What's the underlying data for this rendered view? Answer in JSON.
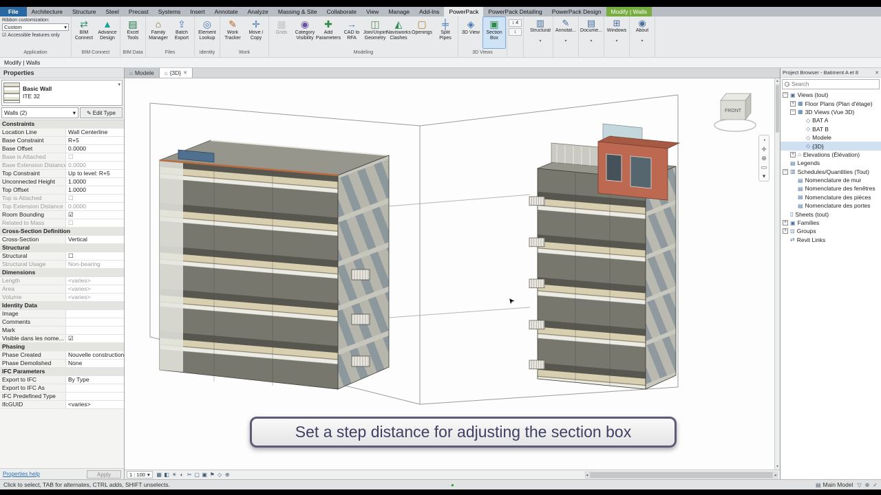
{
  "icons": {
    "caret": "▾",
    "close": "✕",
    "up": "▴",
    "down": "▾",
    "left": "◂",
    "right": "▸",
    "checkbox_checked": "☑",
    "home": "⌂",
    "cursor": "➤"
  },
  "ribbon": {
    "tabs": [
      {
        "label": "File",
        "cls": "file"
      },
      {
        "label": "Architecture"
      },
      {
        "label": "Structure"
      },
      {
        "label": "Steel"
      },
      {
        "label": "Precast"
      },
      {
        "label": "Systems"
      },
      {
        "label": "Insert"
      },
      {
        "label": "Annotate"
      },
      {
        "label": "Analyze"
      },
      {
        "label": "Massing & Site"
      },
      {
        "label": "Collaborate"
      },
      {
        "label": "View"
      },
      {
        "label": "Manage"
      },
      {
        "label": "Add-Ins"
      },
      {
        "label": "PowerPack",
        "cls": "active"
      },
      {
        "label": "PowerPack Detailing"
      },
      {
        "label": "PowerPack Design"
      },
      {
        "label": "Modify | Walls",
        "cls": "modify"
      }
    ],
    "left": {
      "customize_label": "Ribbon customization:",
      "customize_value": "Custom",
      "accessible_label": "Accessible features only",
      "group_label": "Application"
    },
    "groups": [
      {
        "name": "BIM Connect",
        "buttons": [
          {
            "label": "BIM Connect",
            "glyph": "⇄",
            "color": "#2e8b6a"
          },
          {
            "label": "Advance Design",
            "glyph": "▲",
            "color": "#17a398"
          }
        ]
      },
      {
        "name": "BIM Data",
        "buttons": [
          {
            "label": "Excel Tools",
            "glyph": "▤",
            "color": "#1d6f42"
          }
        ]
      },
      {
        "name": "Files",
        "buttons": [
          {
            "label": "Family Manager",
            "glyph": "⌂",
            "color": "#8a6d3b"
          },
          {
            "label": "Batch Export",
            "glyph": "⇪",
            "color": "#4a7ab5"
          }
        ]
      },
      {
        "name": "Identity",
        "buttons": [
          {
            "label": "Element Lookup",
            "glyph": "◎",
            "color": "#4a7ab5"
          }
        ]
      },
      {
        "name": "Work",
        "buttons": [
          {
            "label": "Work Tracker",
            "glyph": "✎",
            "color": "#b5651d"
          },
          {
            "label": "Move / Copy",
            "glyph": "✛",
            "color": "#4a7ab5"
          }
        ]
      },
      {
        "name": "Modeling",
        "buttons": [
          {
            "label": "Grids",
            "glyph": "▦",
            "color": "#999999",
            "cls": "disabled"
          },
          {
            "label": "Category Visibility",
            "glyph": "◉",
            "color": "#6a4fa3"
          },
          {
            "label": "Add Parameters",
            "glyph": "✚",
            "color": "#2d8a46"
          },
          {
            "label": "CAD to RFA",
            "glyph": "→",
            "color": "#4a7ab5"
          },
          {
            "label": "Join/Unjoin Geometry",
            "glyph": "◫",
            "color": "#5b8c5a"
          },
          {
            "label": "Navisworks Clashes",
            "glyph": "◭",
            "color": "#2e8b57"
          },
          {
            "label": "Openings",
            "glyph": "▢",
            "color": "#b08030"
          },
          {
            "label": "Split Pipes",
            "glyph": "╪",
            "color": "#4a7ab5"
          }
        ]
      },
      {
        "name": "3D Views",
        "buttons": [
          {
            "label": "3D View",
            "glyph": "◈",
            "color": "#4a7ab5"
          },
          {
            "label": "Section Box",
            "glyph": "▣",
            "color": "#2d8a46",
            "cls": "active"
          }
        ]
      }
    ],
    "step": {
      "glyph": "↕",
      "value": "4"
    },
    "panel_buttons": [
      {
        "label": "Structural",
        "glyph": "▥",
        "caret": "▾"
      },
      {
        "label": "Annotat...",
        "glyph": "✎",
        "caret": "▾"
      },
      {
        "label": "Docume...",
        "glyph": "▤",
        "caret": "▾"
      },
      {
        "label": "Windows",
        "glyph": "⊞",
        "caret": "▾"
      },
      {
        "label": "About",
        "glyph": "◉",
        "caret": "▾"
      }
    ],
    "modify_bar": "Modify | Walls"
  },
  "properties": {
    "title": "Properties",
    "type_family": "Basic Wall",
    "type_name": "ITE 32",
    "filter": "Walls (2)",
    "edit_glyph": "✎",
    "edit_type": "Edit Type",
    "help": "Properties help",
    "apply": "Apply",
    "rows": [
      {
        "label": "Constraints",
        "cls": "hdr"
      },
      {
        "label": "Location Line",
        "value": "Wall Centerline"
      },
      {
        "label": "Base Constraint",
        "value": "R+5"
      },
      {
        "label": "Base Offset",
        "value": "0.0000"
      },
      {
        "label": "Base is Attached",
        "value": "☐",
        "cls": "dim"
      },
      {
        "label": "Base Extension Distance",
        "value": "0.0000",
        "cls": "dim"
      },
      {
        "label": "Top Constraint",
        "value": "Up to level: R+5"
      },
      {
        "label": "Unconnected Height",
        "value": "1.0000"
      },
      {
        "label": "Top Offset",
        "value": "1.0000"
      },
      {
        "label": "Top is Attached",
        "value": "☐",
        "cls": "dim"
      },
      {
        "label": "Top Extension Distance",
        "value": "0.0000",
        "cls": "dim"
      },
      {
        "label": "Room Bounding",
        "value": "☑"
      },
      {
        "label": "Related to Mass",
        "value": "☐",
        "cls": "dim"
      },
      {
        "label": "Cross-Section Definition",
        "cls": "hdr"
      },
      {
        "label": "Cross-Section",
        "value": "Vertical"
      },
      {
        "label": "Structural",
        "cls": "hdr"
      },
      {
        "label": "Structural",
        "value": "☐"
      },
      {
        "label": "Structural Usage",
        "value": "Non-bearing",
        "cls": "dim"
      },
      {
        "label": "Dimensions",
        "cls": "hdr"
      },
      {
        "label": "Length",
        "value": "<varies>",
        "cls": "dim"
      },
      {
        "label": "Area",
        "value": "<varies>",
        "cls": "dim"
      },
      {
        "label": "Volume",
        "value": "<varies>",
        "cls": "dim"
      },
      {
        "label": "Identity Data",
        "cls": "hdr"
      },
      {
        "label": "Image",
        "value": ""
      },
      {
        "label": "Comments",
        "value": ""
      },
      {
        "label": "Mark",
        "value": ""
      },
      {
        "label": "Visible dans les nome...",
        "value": "☑"
      },
      {
        "label": "Phasing",
        "cls": "hdr"
      },
      {
        "label": "Phase Created",
        "value": "Nouvelle construction"
      },
      {
        "label": "Phase Demolished",
        "value": "None"
      },
      {
        "label": "IFC Parameters",
        "cls": "hdr"
      },
      {
        "label": "Export to IFC",
        "value": "By Type"
      },
      {
        "label": "Export to IFC As",
        "value": ""
      },
      {
        "label": "IFC Predefined Type",
        "value": ""
      },
      {
        "label": "IfcGUID",
        "value": "<varies>"
      }
    ]
  },
  "viewport": {
    "tabs": [
      {
        "icon": "⌂",
        "label": "Modele"
      },
      {
        "icon": "⌂",
        "label": "{3D}",
        "cls": "active",
        "close": "✕"
      }
    ],
    "caption": "Set a step distance for adjusting the section box",
    "viewcube_front": "FRONT",
    "scale": "1 : 100",
    "viewbar_icons": [
      "▦",
      "◧",
      "☀",
      "◐",
      "✂",
      "▢",
      "▣",
      "⚑",
      "◇",
      "⊕"
    ],
    "navbar_icons": [
      "◔",
      "✛",
      "⊕",
      "▭",
      "▾"
    ]
  },
  "browser": {
    "title": "Project Browser - Batiment A et 8",
    "search_placeholder": "Search",
    "tree": [
      {
        "cls": "lvl0",
        "glyph": "−",
        "icon": "▣",
        "label": "Views (tout)"
      },
      {
        "cls": "lvl1",
        "glyph": "+",
        "icon": "▦",
        "label": "Floor Plans (Plan d'étage)"
      },
      {
        "cls": "lvl1",
        "glyph": "−",
        "icon": "▦",
        "label": "3D Views (Vue 3D)"
      },
      {
        "cls": "lvl2",
        "icon": "◇",
        "label": "BAT A"
      },
      {
        "cls": "lvl2",
        "icon": "◇",
        "label": "BAT B"
      },
      {
        "cls": "lvl2",
        "icon": "◇",
        "label": "Modele"
      },
      {
        "cls": "lvl2 selected",
        "icon": "◇",
        "label": "{3D}"
      },
      {
        "cls": "lvl1",
        "glyph": "+",
        "icon": "⌂",
        "label": "Elevations (Élévation)"
      },
      {
        "cls": "lvl0",
        "icon": "▤",
        "label": "Legends"
      },
      {
        "cls": "lvl0",
        "glyph": "−",
        "icon": "▥",
        "label": "Schedules/Quantities (Tout)"
      },
      {
        "cls": "lvl1",
        "icon": "▤",
        "label": "Nomenclature de mur"
      },
      {
        "cls": "lvl1",
        "icon": "▤",
        "label": "Nomenclature des fenêtres"
      },
      {
        "cls": "lvl1",
        "icon": "▤",
        "label": "Nomenclature des pièces"
      },
      {
        "cls": "lvl1",
        "icon": "▤",
        "label": "Nomenclature des portes"
      },
      {
        "cls": "lvl0",
        "icon": "▯",
        "label": "Sheets (tout)"
      },
      {
        "cls": "lvl0",
        "glyph": "+",
        "icon": "▣",
        "label": "Families"
      },
      {
        "cls": "lvl0",
        "glyph": "+",
        "icon": "⊡",
        "label": "Groups"
      },
      {
        "cls": "lvl0",
        "icon": "⇄",
        "label": "Revit Links"
      }
    ]
  },
  "statusbar": {
    "hint": "Click to select, TAB for alternates, CTRL adds, SHIFT unselects.",
    "center_glyph": "●",
    "main_model_glyph": "▤",
    "main_model_label": "Main Model",
    "right_icons": [
      "▽",
      "⊕",
      "✓"
    ]
  }
}
